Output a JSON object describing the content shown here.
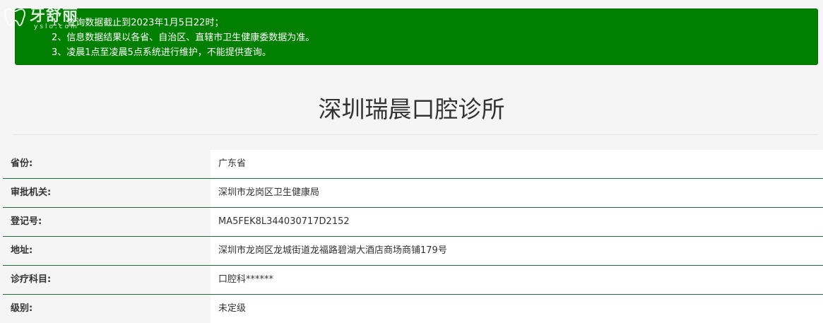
{
  "notice": {
    "items": [
      "1、查询数据截止到2023年1月5日22时；",
      "2、信息数据结果以各省、自治区、直辖市卫生健康委数据为准。",
      "3、凌晨1点至凌晨5点系统进行维护，不能提供查询。"
    ],
    "background_color": "#007f00"
  },
  "watermark": {
    "text": "牙舒丽",
    "sub": "yslo.com"
  },
  "title": "深圳瑞晨口腔诊所",
  "details": [
    {
      "label": "省份:",
      "value": "广东省"
    },
    {
      "label": "审批机关:",
      "value": "深圳市龙岗区卫生健康局"
    },
    {
      "label": "登记号:",
      "value": "MA5FEK8L344030717D2152"
    },
    {
      "label": "地址:",
      "value": "深圳市龙岗区龙城街道龙福路碧湖大酒店商场商铺179号"
    },
    {
      "label": "诊疗科目:",
      "value": "口腔科******"
    },
    {
      "label": "级别:",
      "value": "未定级"
    }
  ],
  "colors": {
    "row_divider": "#1f6b3b"
  }
}
